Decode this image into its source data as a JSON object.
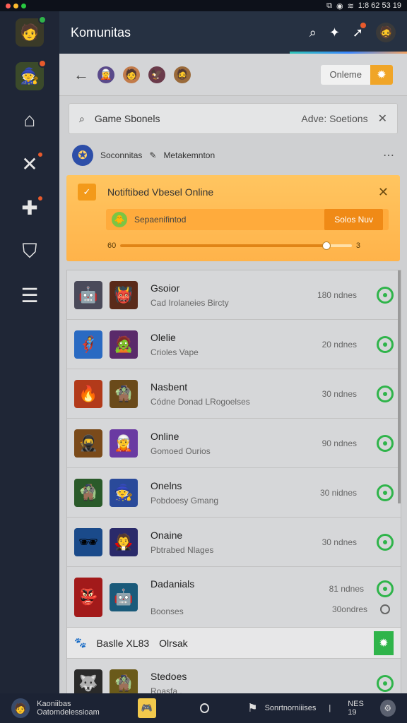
{
  "statusbar": {
    "time": "1:8 62 53 19"
  },
  "header": {
    "title": "Komunitas"
  },
  "subbar": {
    "online_label": "Onleme"
  },
  "search": {
    "left": "Game Sbonels",
    "right": "Adve: Soetions"
  },
  "community": {
    "name": "Soconnitas",
    "tag": "Metakemnton"
  },
  "notice": {
    "title": "Notiftibed Vbesel Online",
    "item": "Sepaenifintod",
    "button": "Solos Nuv",
    "progress_left": "60",
    "progress_right": "3",
    "progress_fraction": 0.89
  },
  "rows": [
    {
      "name": "Gsoior",
      "sub": "Cad Irolaneies Bircty",
      "time": "180 ndnes"
    },
    {
      "name": "Olelie",
      "sub": "Crioles Vape",
      "time": "20 ndnes"
    },
    {
      "name": "Nasbent",
      "sub": "Códne Donad LRogoelses",
      "time": "30 ndnes"
    },
    {
      "name": "Online",
      "sub": "Gomoed Ourios",
      "time": "90 ndnes"
    },
    {
      "name": "Onelns",
      "sub": "Pobdoesy Gmang",
      "time": "30 nidnes"
    },
    {
      "name": "Onaine",
      "sub": "Pbtrabed Nlages",
      "time": "30 ndnes"
    },
    {
      "name": "Dadanials",
      "sub": "Boonses",
      "time": "81 ndnes",
      "time2": "30ondres"
    }
  ],
  "extra_bar": {
    "label": "Baslle XL83",
    "label2": "Olrsak"
  },
  "last_row": {
    "name": "Stedoes",
    "sub": "Roasfa ."
  },
  "bottombar": {
    "name": "Kaoniibas",
    "sub": "Oatomdelessioam",
    "app_text": "Sonrtnorniiises",
    "sep": "|",
    "count": "NES 19"
  },
  "colors": {
    "accent": "#f0a528",
    "online_green": "#2fb44a",
    "header_bg": "#263142"
  }
}
